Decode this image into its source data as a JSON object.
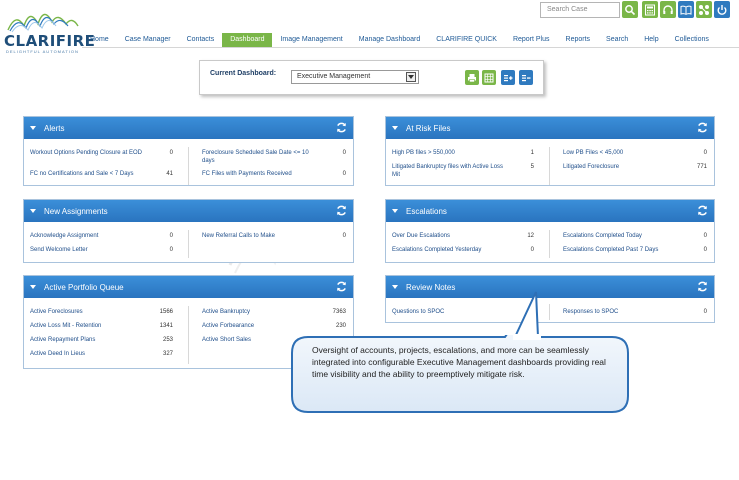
{
  "brand": {
    "name": "CLARIFIRE",
    "tagline": "DELIGHTFUL AUTOMATION"
  },
  "search": {
    "placeholder": "Search Case"
  },
  "header_icons": [
    "search-icon",
    "calculator-icon",
    "headset-icon",
    "book-icon",
    "network-icon",
    "power-icon"
  ],
  "nav": [
    "Home",
    "Case Manager",
    "Contacts",
    "Dashboard",
    "Image Management",
    "Manage Dashboard",
    "CLARIFIRE QUICK",
    "Report Plus",
    "Reports",
    "Search",
    "Help",
    "Collections"
  ],
  "nav_active": "Dashboard",
  "current_dashboard": {
    "label": "Current Dashboard:",
    "selected": "Executive Management"
  },
  "widgets": {
    "alerts": {
      "title": "Alerts",
      "left": [
        {
          "label": "Workout Options Pending Closure at EOD",
          "value": "0"
        },
        {
          "label": "FC no Certifications and Sale < 7 Days",
          "value": "41"
        }
      ],
      "right": [
        {
          "label": "Foreclosure Scheduled Sale Date <= 10 days",
          "value": "0"
        },
        {
          "label": "FC Files with Payments Received",
          "value": "0"
        }
      ]
    },
    "at_risk": {
      "title": "At Risk Files",
      "left": [
        {
          "label": "High PB files > 550,000",
          "value": "1"
        },
        {
          "label": "Litigated Bankruptcy files with Active Loss Mit",
          "value": "5"
        }
      ],
      "right": [
        {
          "label": "Low PB Files < 45,000",
          "value": "0"
        },
        {
          "label": "Litigated Foreclosure",
          "value": "771"
        }
      ]
    },
    "new_assignments": {
      "title": "New Assignments",
      "left": [
        {
          "label": "Acknowledge Assignment",
          "value": "0"
        },
        {
          "label": "Send Welcome Letter",
          "value": "0"
        }
      ],
      "right": [
        {
          "label": "New Referral Calls to Make",
          "value": "0"
        }
      ]
    },
    "escalations": {
      "title": "Escalations",
      "left": [
        {
          "label": "Over Due Escalations",
          "value": "12"
        },
        {
          "label": "Escalations Completed Yesterday",
          "value": "0"
        }
      ],
      "right": [
        {
          "label": "Escalations Completed Today",
          "value": "0"
        },
        {
          "label": "Escalations Completed Past 7 Days",
          "value": "0"
        }
      ]
    },
    "active_portfolio": {
      "title": "Active Portfolio Queue",
      "left": [
        {
          "label": "Active Foreclosures",
          "value": "1566"
        },
        {
          "label": "Active Loss Mit - Retention",
          "value": "1341"
        },
        {
          "label": "Active Repayment Plans",
          "value": "253"
        },
        {
          "label": "Active Deed In Lieus",
          "value": "327"
        }
      ],
      "right": [
        {
          "label": "Active Bankruptcy",
          "value": "7363"
        },
        {
          "label": "Active Forbearance",
          "value": "230"
        },
        {
          "label": "Active Short Sales",
          "value": ""
        }
      ]
    },
    "review_notes": {
      "title": "Review Notes",
      "left": [
        {
          "label": "Questions to SPOC",
          "value": ""
        }
      ],
      "right": [
        {
          "label": "Responses to SPOC",
          "value": "0"
        }
      ]
    }
  },
  "callout": "Oversight of accounts, projects, escalations, and more can be seamlessly integrated into configurable Executive Management dashboards providing real time visibility and the ability to preemptively mitigate risk.",
  "colors": {
    "accent_green": "#7ab648",
    "header_blue": "#2f7abf",
    "link_blue": "#1f5a96"
  }
}
